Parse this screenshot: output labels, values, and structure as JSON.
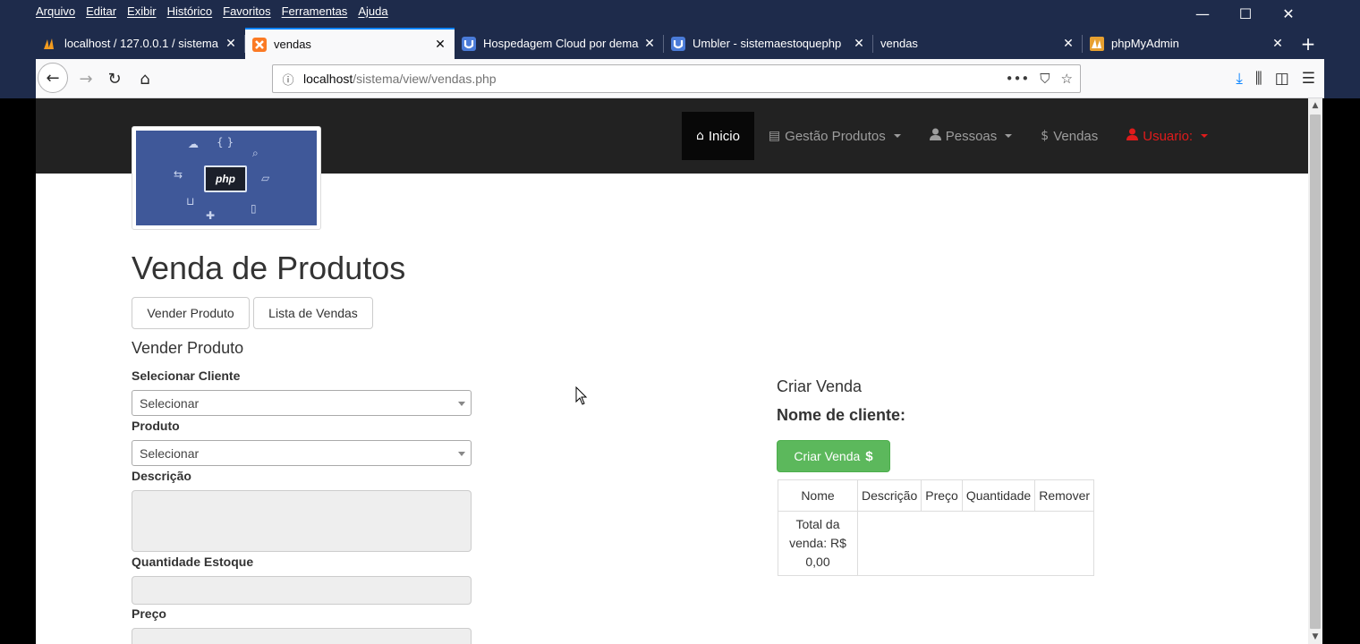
{
  "browser": {
    "menu": [
      "Arquivo",
      "Editar",
      "Exibir",
      "Histórico",
      "Favoritos",
      "Ferramentas",
      "Ajuda"
    ],
    "window_controls": [
      "—",
      "☐",
      "✕"
    ],
    "tabs": [
      {
        "title": "localhost / 127.0.0.1 / sistema",
        "favicon": "phpmyadmin-icon",
        "active": false
      },
      {
        "title": "vendas",
        "favicon": "xampp-icon",
        "active": true
      },
      {
        "title": "Hospedagem Cloud por dema",
        "favicon": "umbler-icon",
        "active": false
      },
      {
        "title": "Umbler - sistemaestoquephp",
        "favicon": "umbler-icon",
        "active": false
      },
      {
        "title": "vendas",
        "favicon": "",
        "active": false
      },
      {
        "title": "phpMyAdmin",
        "favicon": "phpmyadmin-icon",
        "active": false
      }
    ],
    "close_glyph": "✕",
    "new_tab_glyph": "+",
    "url": {
      "host": "localhost",
      "path": "/sistema/view/vendas.php"
    },
    "accent": "#0a84ff"
  },
  "site": {
    "nav": {
      "inicio": "Inicio",
      "gestao": "Gestão Produtos",
      "pessoas": "Pessoas",
      "vendas": "Vendas",
      "usuario": "Usuario:"
    },
    "logo_text": "php",
    "page_title": "Venda de Produtos",
    "buttons": {
      "vender": "Vender Produto",
      "lista": "Lista de Vendas"
    },
    "form": {
      "title": "Vender Produto",
      "cliente_label": "Selecionar Cliente",
      "cliente_value": "Selecionar",
      "produto_label": "Produto",
      "produto_value": "Selecionar",
      "descricao_label": "Descrição",
      "quantidade_label": "Quantidade Estoque",
      "preco_label": "Preço"
    },
    "sale": {
      "title": "Criar Venda",
      "cliente_label": "Nome de cliente:",
      "criar_button": "Criar Venda",
      "dollar": "$",
      "table_headers": [
        "Nome",
        "Descrição",
        "Preço",
        "Quantidade",
        "Remover"
      ],
      "total_line1": "Total da",
      "total_line2": "venda: R$",
      "total_line3": "0,00"
    },
    "colors": {
      "navbar": "#222222",
      "success": "#5cb85c",
      "user": "#e01b1b"
    }
  }
}
